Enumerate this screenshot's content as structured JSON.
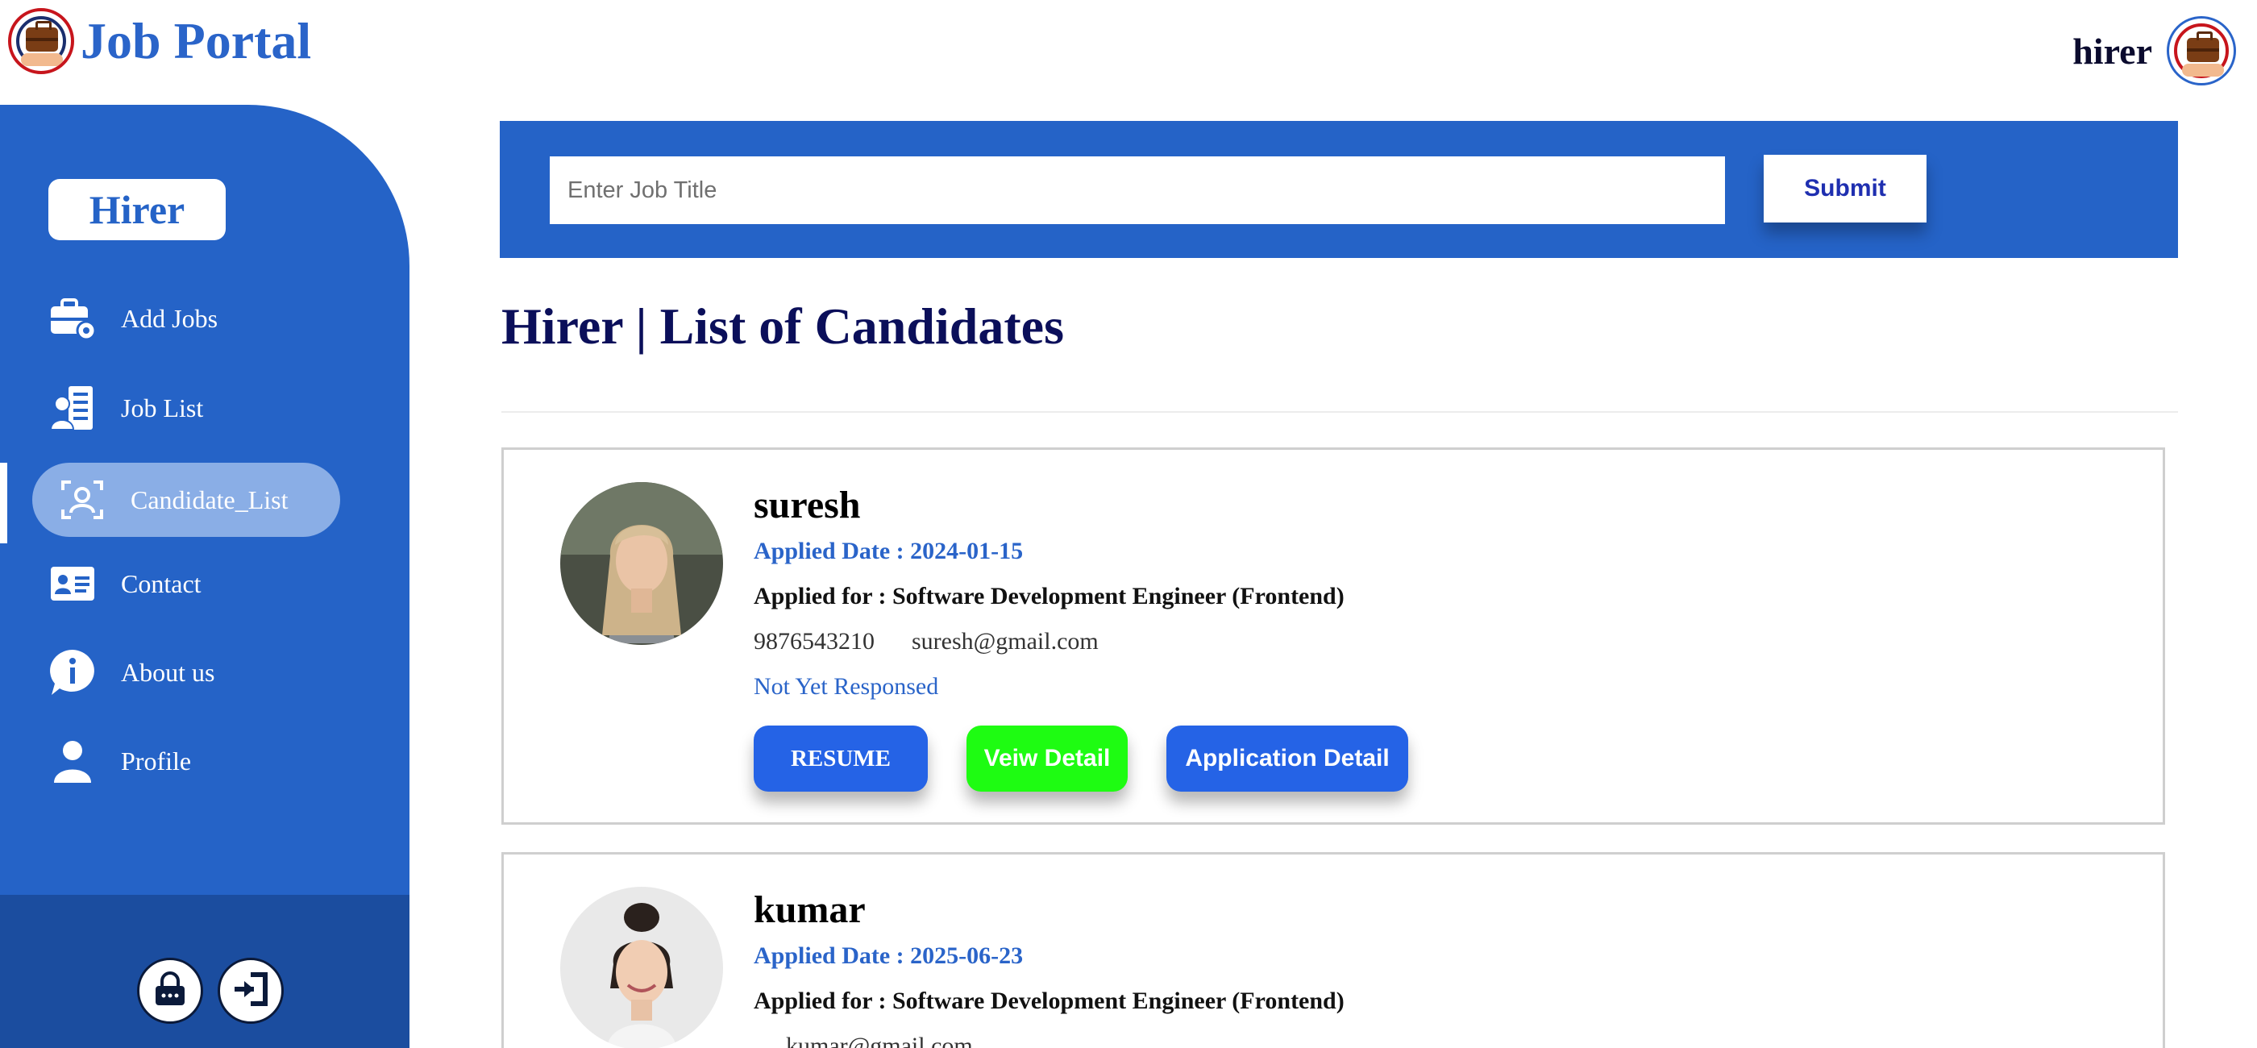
{
  "header": {
    "app_title": "Job Portal",
    "user_name": "hirer"
  },
  "sidebar": {
    "role_label": "Hirer",
    "items": [
      {
        "label": "Add Jobs",
        "icon": "briefcase-gear-icon"
      },
      {
        "label": "Job List",
        "icon": "user-list-icon"
      },
      {
        "label": "Candidate_List",
        "icon": "user-scan-icon",
        "active": true
      },
      {
        "label": "Contact",
        "icon": "contact-card-icon"
      },
      {
        "label": "About us",
        "icon": "info-bubble-icon"
      },
      {
        "label": "Profile",
        "icon": "person-icon"
      }
    ],
    "bottom_icons": [
      "lock-icon",
      "logout-icon"
    ]
  },
  "search": {
    "placeholder": "Enter Job Title",
    "value": "",
    "submit_label": "Submit"
  },
  "page_title": "Hirer | List of Candidates",
  "candidates": [
    {
      "name": "suresh",
      "applied_date": "Applied Date : 2024-01-15",
      "applied_for": "Applied for : Software Development Engineer (Frontend)",
      "phone": "9876543210",
      "email": "suresh@gmail.com",
      "status": "Not Yet Responsed"
    },
    {
      "name": "kumar",
      "applied_date": "Applied Date : 2025-06-23",
      "applied_for": "Applied for : Software Development Engineer (Frontend)",
      "phone": "",
      "email": "kumar@gmail.com",
      "status": ""
    }
  ],
  "card_buttons": {
    "resume": "RESUME",
    "view_detail": "Veiw Detail",
    "application_detail": "Application Detail"
  },
  "colors": {
    "primary": "#2563c7",
    "sidebar_bottom": "#1b4d9f",
    "title_navy": "#0b0f5a",
    "accent_green": "#1efc12",
    "button_blue": "#2563e6"
  }
}
